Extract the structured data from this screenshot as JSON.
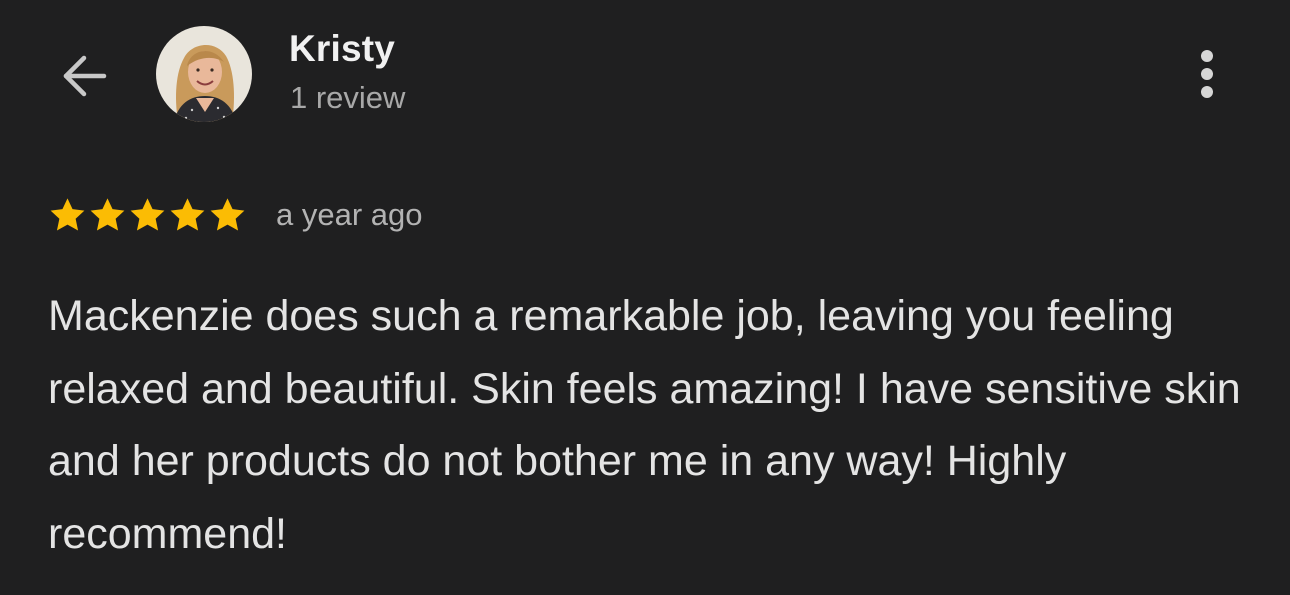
{
  "header": {
    "back_icon": "arrow-left-icon",
    "user_name": "Kristy",
    "review_count": "1 review",
    "more_icon": "more-vertical-icon"
  },
  "review": {
    "rating": 5,
    "max_rating": 5,
    "time": "a year ago",
    "text": "Mackenzie does such a remarkable job, leaving you feeling relaxed and beautiful. Skin feels amazing! I have sensitive skin and her products do not bother me in any way! Highly recommend!"
  },
  "colors": {
    "background": "#1f1f20",
    "star": "#fbbc04",
    "primary_text": "#f1f1f1",
    "secondary_text": "#a8a8a8"
  }
}
